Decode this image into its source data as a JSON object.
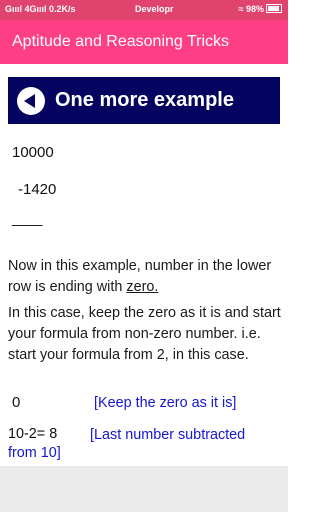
{
  "status_bar": {
    "signal": "Gıııl 4Gıııl",
    "speed": "0.2K/s",
    "center": "Developr",
    "battery": "98%"
  },
  "app_bar": {
    "title": "Aptitude and Reasoning Tricks"
  },
  "banner": {
    "text": "One more example"
  },
  "example": {
    "top": "10000",
    "subtract": "-1420",
    "line": "____"
  },
  "paragraph1": {
    "text": "Now in this example, number in the lower row is ending with ",
    "underlined": "zero."
  },
  "paragraph2": "In this case, keep the zero as it is and start your formula from non-zero number. i.e. start your formula from 2, in this case.",
  "step1": {
    "value": "0",
    "note": "[Keep the zero as it is]"
  },
  "step2": {
    "value": "10-2= 8",
    "note_line1": "[Last number subtracted",
    "note_line2": "from 10]"
  }
}
